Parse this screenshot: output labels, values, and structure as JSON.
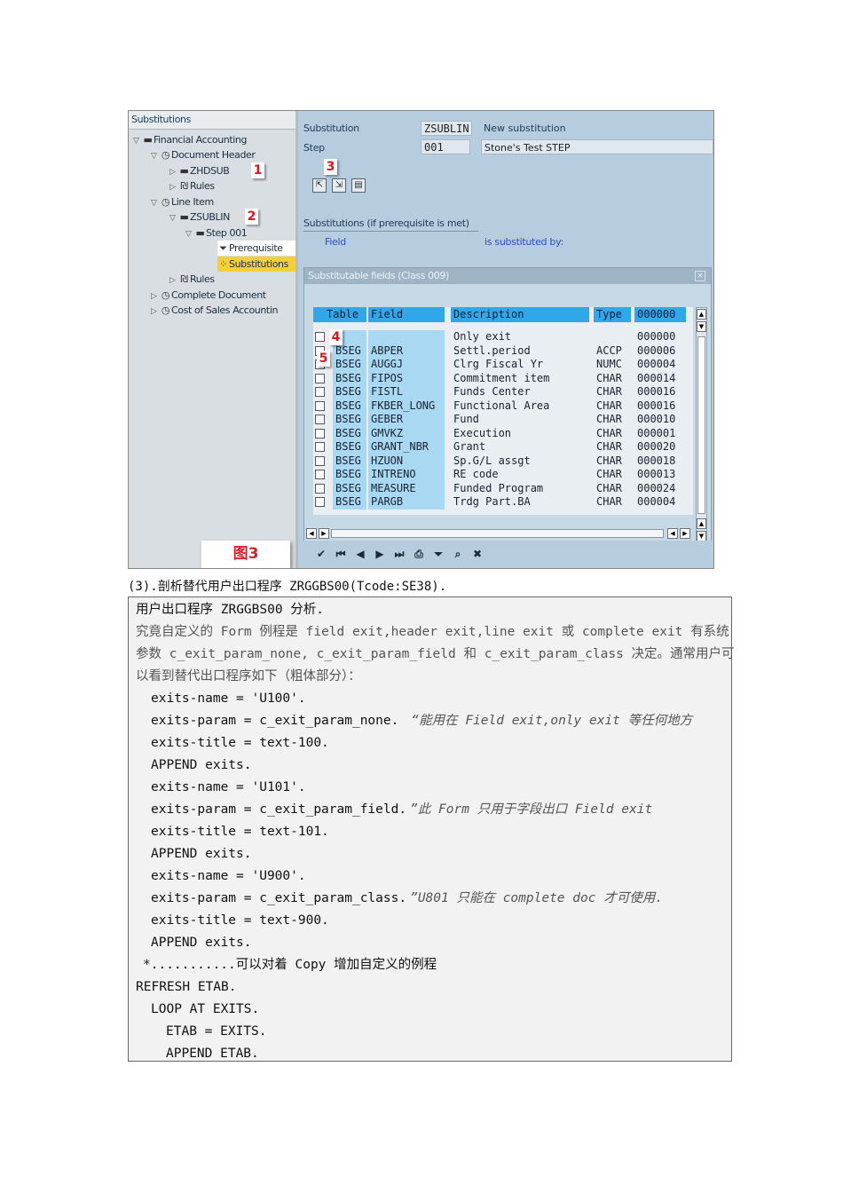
{
  "screenshot": {
    "tree": {
      "header": "Substitutions",
      "nodes": [
        {
          "label": "Financial Accounting",
          "icon": "folder-icon"
        },
        {
          "label": "Document Header",
          "icon": "clock-icon"
        },
        {
          "label": "ZHDSUB",
          "icon": "folder-icon"
        },
        {
          "label": "Rules",
          "icon": "rules-icon"
        },
        {
          "label": "Line Item",
          "icon": "clock-icon"
        },
        {
          "label": "ZSUBLIN",
          "icon": "folder-icon"
        },
        {
          "label": "Step 001",
          "icon": "folder-icon"
        },
        {
          "label": "Prerequisite",
          "icon": "filter-icon"
        },
        {
          "label": "Substitutions",
          "icon": "substitutions-icon"
        },
        {
          "label": "Rules",
          "icon": "rules-icon"
        },
        {
          "label": "Complete Document",
          "icon": "clock-icon"
        },
        {
          "label": "Cost of Sales Accountin",
          "icon": "clock-icon"
        }
      ]
    },
    "header": {
      "substitution_label": "Substitution",
      "substitution_value": "ZSUBLIN",
      "substitution_desc": "New substitution",
      "step_label": "Step",
      "step_value": "001",
      "step_desc": "Stone's Test STEP"
    },
    "badges": [
      "1",
      "2",
      "3",
      "4",
      "5"
    ],
    "subst_panel": {
      "tab": "Substitutions (if prerequisite is met)",
      "col_field": "Field",
      "col_subst": "is substituted by:"
    },
    "dialog": {
      "title": "Substitutable fields (Class 009)",
      "close": "×",
      "columns": [
        "Table",
        "Field",
        "Description",
        "Type",
        "000000"
      ],
      "rows": [
        [
          "",
          "",
          "Only exit",
          "",
          "000000"
        ],
        [
          "BSEG",
          "ABPER",
          "Settl.period",
          "ACCP",
          "000006"
        ],
        [
          "BSEG",
          "AUGGJ",
          "Clrg Fiscal Yr",
          "NUMC",
          "000004"
        ],
        [
          "BSEG",
          "FIPOS",
          "Commitment item",
          "CHAR",
          "000014"
        ],
        [
          "BSEG",
          "FISTL",
          "Funds Center",
          "CHAR",
          "000016"
        ],
        [
          "BSEG",
          "FKBER_LONG",
          "Functional Area",
          "CHAR",
          "000016"
        ],
        [
          "BSEG",
          "GEBER",
          "Fund",
          "CHAR",
          "000010"
        ],
        [
          "BSEG",
          "GMVKZ",
          "Execution",
          "CHAR",
          "000001"
        ],
        [
          "BSEG",
          "GRANT_NBR",
          "Grant",
          "CHAR",
          "000020"
        ],
        [
          "BSEG",
          "HZUON",
          "Sp.G/L assgt",
          "CHAR",
          "000018"
        ],
        [
          "BSEG",
          "INTRENO",
          "RE code",
          "CHAR",
          "000013"
        ],
        [
          "BSEG",
          "MEASURE",
          "Funded Program",
          "CHAR",
          "000024"
        ],
        [
          "BSEG",
          "PARGB",
          "Trdg Part.BA",
          "CHAR",
          "000004"
        ]
      ]
    },
    "figure_label": "图3"
  },
  "caption": "(3).剖析替代用户出口程序 ZRGGBS00(Tcode:SE38).",
  "box": {
    "title": "用户出口程序 ZRGGBS00 分析.",
    "intro1": "究竟自定义的 Form 例程是 field exit,header exit,line exit 或 complete exit 有系统",
    "intro2": "参数 c_exit_param_none, c_exit_param_field 和 c_exit_param_class 决定。通常用户可",
    "intro3": "以看到替代出口程序如下（粗体部分）：",
    "code1": "exits-name  = 'U100'.",
    "code2a": "exits-param = c_exit_param_none.",
    "code2b": "“能用在 Field exit,only exit 等任何地方",
    "code3": "exits-title = text-100.",
    "code4": "APPEND exits.",
    "code5": "exits-name  = 'U101'.",
    "code6a": "exits-param = c_exit_param_field.",
    "code6b": "”此 Form 只用于字段出口 Field exit",
    "code7": "exits-title = text-101.",
    "code8": "APPEND exits.",
    "code9": "exits-name  = 'U900'.",
    "code10a": "exits-param = c_exit_param_class.",
    "code10b": "”U801 只能在 complete doc 才可使用.",
    "code11": "exits-title = text-900.",
    "code12": "APPEND exits.",
    "code13": "*...........可以对着 Copy 增加自定义的例程",
    "code14": "REFRESH ETAB.",
    "code15": "LOOP AT EXITS.",
    "code16": "ETAB = EXITS.",
    "code17": "APPEND ETAB."
  }
}
